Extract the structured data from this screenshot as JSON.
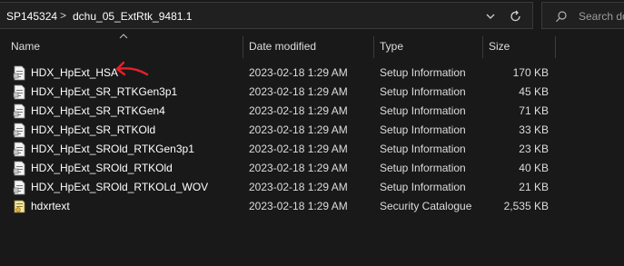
{
  "breadcrumb": {
    "items": [
      "SP145324",
      "dchu_05_ExtRtk_9481.1"
    ],
    "separator": ">"
  },
  "search": {
    "placeholder": "Search dc"
  },
  "columns": {
    "name": "Name",
    "date": "Date modified",
    "type": "Type",
    "size": "Size"
  },
  "files": [
    {
      "name": "HDX_HpExt_HSA",
      "date": "2023-02-18 1:29 AM",
      "type": "Setup Information",
      "size": "170 KB",
      "icon": "setup-information-file-icon"
    },
    {
      "name": "HDX_HpExt_SR_RTKGen3p1",
      "date": "2023-02-18 1:29 AM",
      "type": "Setup Information",
      "size": "45 KB",
      "icon": "setup-information-file-icon"
    },
    {
      "name": "HDX_HpExt_SR_RTKGen4",
      "date": "2023-02-18 1:29 AM",
      "type": "Setup Information",
      "size": "71 KB",
      "icon": "setup-information-file-icon"
    },
    {
      "name": "HDX_HpExt_SR_RTKOld",
      "date": "2023-02-18 1:29 AM",
      "type": "Setup Information",
      "size": "33 KB",
      "icon": "setup-information-file-icon"
    },
    {
      "name": "HDX_HpExt_SROld_RTKGen3p1",
      "date": "2023-02-18 1:29 AM",
      "type": "Setup Information",
      "size": "23 KB",
      "icon": "setup-information-file-icon"
    },
    {
      "name": "HDX_HpExt_SROld_RTKOld",
      "date": "2023-02-18 1:29 AM",
      "type": "Setup Information",
      "size": "40 KB",
      "icon": "setup-information-file-icon"
    },
    {
      "name": "HDX_HpExt_SROld_RTKOLd_WOV",
      "date": "2023-02-18 1:29 AM",
      "type": "Setup Information",
      "size": "21 KB",
      "icon": "setup-information-file-icon"
    },
    {
      "name": "hdxrtext",
      "date": "2023-02-18 1:29 AM",
      "type": "Security Catalogue",
      "size": "2,535 KB",
      "icon": "security-catalog-file-icon"
    }
  ],
  "colors": {
    "background": "#191919",
    "annotation": "#e8202a"
  }
}
